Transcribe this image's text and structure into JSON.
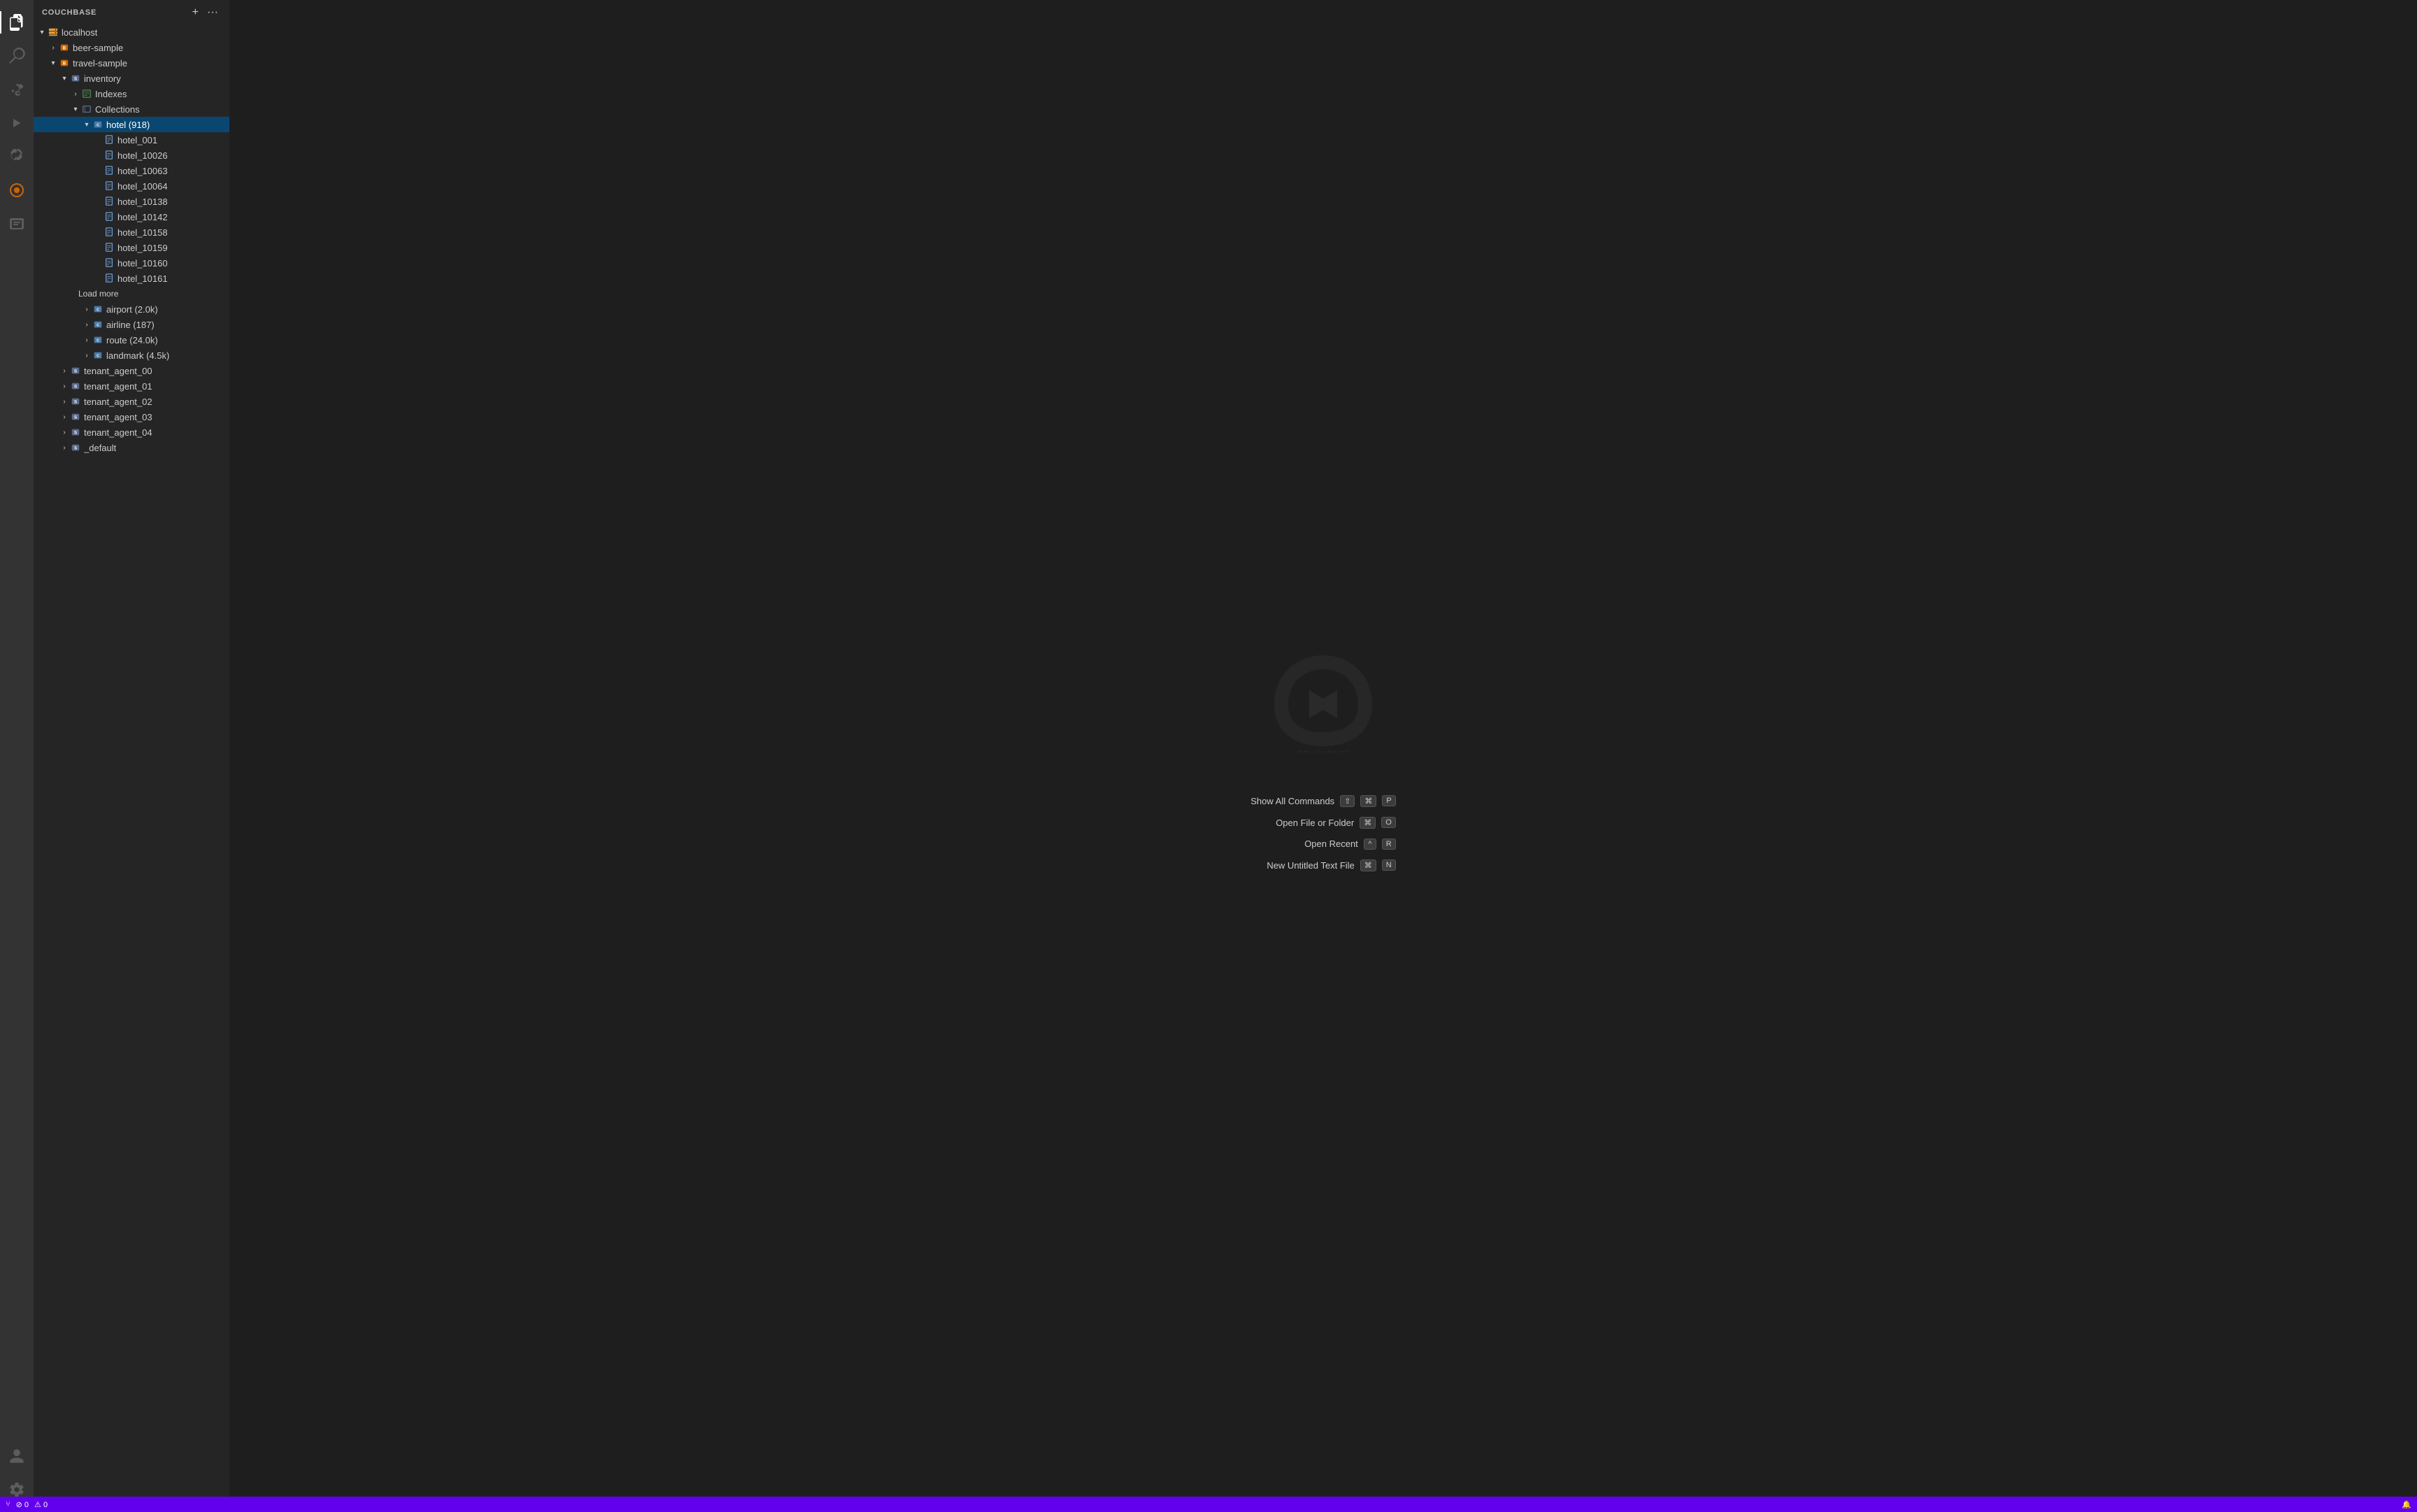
{
  "app": {
    "title": "COUCHBASE"
  },
  "activity_bar": {
    "items": [
      {
        "name": "explorer-icon",
        "icon": "⊞",
        "active": true
      },
      {
        "name": "search-icon",
        "icon": "🔍",
        "active": false
      },
      {
        "name": "source-control-icon",
        "icon": "⑂",
        "active": false
      },
      {
        "name": "run-icon",
        "icon": "▷",
        "active": false
      },
      {
        "name": "extensions-icon",
        "icon": "⧉",
        "active": false
      },
      {
        "name": "couchbase-icon",
        "icon": "●",
        "active": false
      },
      {
        "name": "query-icon",
        "icon": "◈",
        "active": false
      }
    ],
    "bottom_items": [
      {
        "name": "accounts-icon",
        "icon": "👤"
      },
      {
        "name": "settings-icon",
        "icon": "⚙"
      }
    ]
  },
  "sidebar": {
    "title": "COUCHBASE",
    "add_button_label": "+",
    "more_button_label": "···",
    "tree": {
      "nodes": [
        {
          "id": "localhost",
          "label": "localhost",
          "indent": 0,
          "expanded": true,
          "icon": "server",
          "type": "server"
        },
        {
          "id": "beer-sample",
          "label": "beer-sample",
          "indent": 1,
          "expanded": false,
          "icon": "bucket",
          "type": "bucket"
        },
        {
          "id": "travel-sample",
          "label": "travel-sample",
          "indent": 1,
          "expanded": false,
          "icon": "bucket",
          "type": "bucket"
        },
        {
          "id": "inventory",
          "label": "inventory",
          "indent": 2,
          "expanded": true,
          "icon": "scope",
          "type": "scope"
        },
        {
          "id": "indexes",
          "label": "Indexes",
          "indent": 3,
          "expanded": false,
          "icon": "indexes",
          "type": "indexes"
        },
        {
          "id": "collections",
          "label": "Collections",
          "indent": 3,
          "expanded": true,
          "icon": "collections",
          "type": "collections"
        },
        {
          "id": "hotel",
          "label": "hotel (918)",
          "indent": 4,
          "expanded": true,
          "icon": "collection",
          "type": "collection",
          "selected": true
        },
        {
          "id": "hotel_001",
          "label": "hotel_001",
          "indent": 5,
          "icon": "document",
          "type": "document"
        },
        {
          "id": "hotel_10026",
          "label": "hotel_10026",
          "indent": 5,
          "icon": "document",
          "type": "document"
        },
        {
          "id": "hotel_10063",
          "label": "hotel_10063",
          "indent": 5,
          "icon": "document",
          "type": "document"
        },
        {
          "id": "hotel_10064",
          "label": "hotel_10064",
          "indent": 5,
          "icon": "document",
          "type": "document"
        },
        {
          "id": "hotel_10138",
          "label": "hotel_10138",
          "indent": 5,
          "icon": "document",
          "type": "document"
        },
        {
          "id": "hotel_10142",
          "label": "hotel_10142",
          "indent": 5,
          "icon": "document",
          "type": "document"
        },
        {
          "id": "hotel_10158",
          "label": "hotel_10158",
          "indent": 5,
          "icon": "document",
          "type": "document"
        },
        {
          "id": "hotel_10159",
          "label": "hotel_10159",
          "indent": 5,
          "icon": "document",
          "type": "document"
        },
        {
          "id": "hotel_10160",
          "label": "hotel_10160",
          "indent": 5,
          "icon": "document",
          "type": "document"
        },
        {
          "id": "hotel_10161",
          "label": "hotel_10161",
          "indent": 5,
          "icon": "document",
          "type": "document"
        },
        {
          "id": "load-more",
          "label": "Load more",
          "indent": 5,
          "icon": "",
          "type": "load-more"
        },
        {
          "id": "airport",
          "label": "airport (2.0k)",
          "indent": 4,
          "expanded": false,
          "icon": "collection",
          "type": "collection"
        },
        {
          "id": "airline",
          "label": "airline (187)",
          "indent": 4,
          "expanded": false,
          "icon": "collection",
          "type": "collection"
        },
        {
          "id": "route",
          "label": "route (24.0k)",
          "indent": 4,
          "expanded": false,
          "icon": "collection",
          "type": "collection"
        },
        {
          "id": "landmark",
          "label": "landmark (4.5k)",
          "indent": 4,
          "expanded": false,
          "icon": "collection",
          "type": "collection"
        },
        {
          "id": "tenant_agent_00",
          "label": "tenant_agent_00",
          "indent": 2,
          "expanded": false,
          "icon": "scope",
          "type": "scope"
        },
        {
          "id": "tenant_agent_01",
          "label": "tenant_agent_01",
          "indent": 2,
          "expanded": false,
          "icon": "scope",
          "type": "scope"
        },
        {
          "id": "tenant_agent_02",
          "label": "tenant_agent_02",
          "indent": 2,
          "expanded": false,
          "icon": "scope",
          "type": "scope"
        },
        {
          "id": "tenant_agent_03",
          "label": "tenant_agent_03",
          "indent": 2,
          "expanded": false,
          "icon": "scope",
          "type": "scope"
        },
        {
          "id": "tenant_agent_04",
          "label": "tenant_agent_04",
          "indent": 2,
          "expanded": false,
          "icon": "scope",
          "type": "scope"
        },
        {
          "id": "_default",
          "label": "_default",
          "indent": 2,
          "expanded": false,
          "icon": "scope",
          "type": "scope"
        }
      ]
    }
  },
  "welcome": {
    "shortcuts": [
      {
        "label": "Show All Commands",
        "keys": [
          "⇧",
          "⌘",
          "P"
        ]
      },
      {
        "label": "Open File or Folder",
        "keys": [
          "⌘",
          "O"
        ]
      },
      {
        "label": "Open Recent",
        "keys": [
          "^",
          "R"
        ]
      },
      {
        "label": "New Untitled Text File",
        "keys": [
          "⌘",
          "N"
        ]
      }
    ]
  },
  "status_bar": {
    "left": [
      {
        "icon": "⑂",
        "label": ""
      }
    ],
    "errors": "0",
    "warnings": "0",
    "right_items": []
  },
  "colors": {
    "activity_bar_bg": "#333333",
    "sidebar_bg": "#252526",
    "editor_bg": "#1e1e1e",
    "selected_bg": "#094771",
    "status_bar_bg": "#6200ee",
    "hover_bg": "#2a2d2e"
  }
}
